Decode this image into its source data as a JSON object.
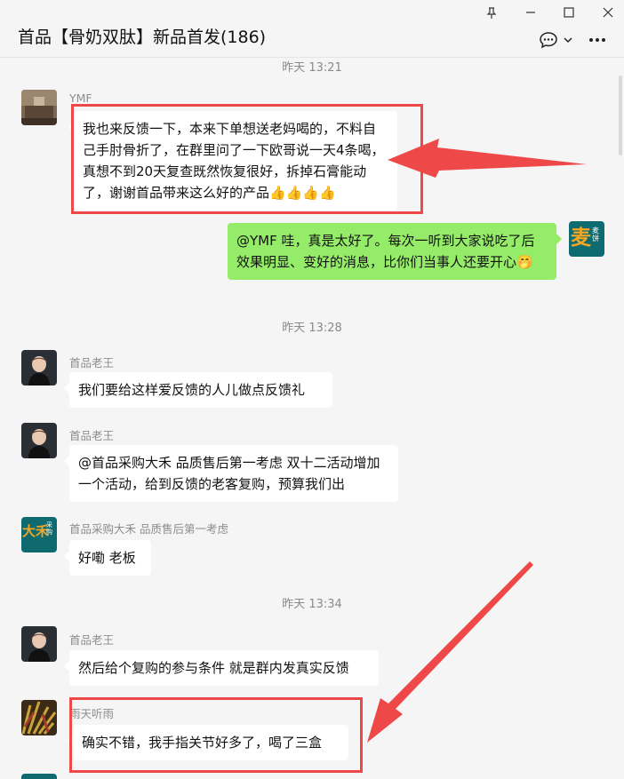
{
  "window": {
    "pin_icon": "pin-icon",
    "controls": [
      "minimize-icon",
      "maximize-icon",
      "close-icon"
    ]
  },
  "header": {
    "title": "首品【骨奶双肽】新品首发(186)"
  },
  "messages": {
    "t1": "昨天 13:21",
    "ymf_name": "YMF",
    "ymf_text": "我也来反馈一下，本来下单想送老妈喝的，不料自己手肘骨折了，在群里问了一下欧哥说一天4条喝，真想不到20天复查既然恢复很好，拆掉石膏能动了，谢谢首品带来这么好的产品",
    "thumbs": "👍👍👍👍",
    "me_text": "@YMF  哇，真是太好了。每次一听到大家说吃了后效果明显、变好的消息，比你们当事人还要开心",
    "me_emoji": "🤭",
    "t2": "昨天 13:28",
    "wang_name1": "首品老王",
    "wang_text1": "我们要给这样爱反馈的人儿做点反馈礼",
    "wang_name2": "首品老王",
    "wang_text2": "@首品采购大禾  品质售后第一考虑  双十二活动增加一个活动，给到反馈的老客复购，预算我们出",
    "dahe_name": "首品采购大禾  品质售后第一考虑",
    "dahe_text": "好嘞 老板",
    "t3": "昨天 13:34",
    "wang_name3": "首品老王",
    "wang_text3": "然后给个复购的参与条件 就是群内发真实反馈",
    "rain_name": "雨天听雨",
    "rain_text": "确实不错，我手指关节好多了，喝了三盒"
  },
  "avatars": {
    "me_big": "麦",
    "me_small": "麦饼",
    "dahe_big": "大禾",
    "dahe_small": "采购"
  },
  "colors": {
    "accent_green": "#95ec69",
    "annotation_red": "#ef4848",
    "bg": "#f5f5f5"
  }
}
